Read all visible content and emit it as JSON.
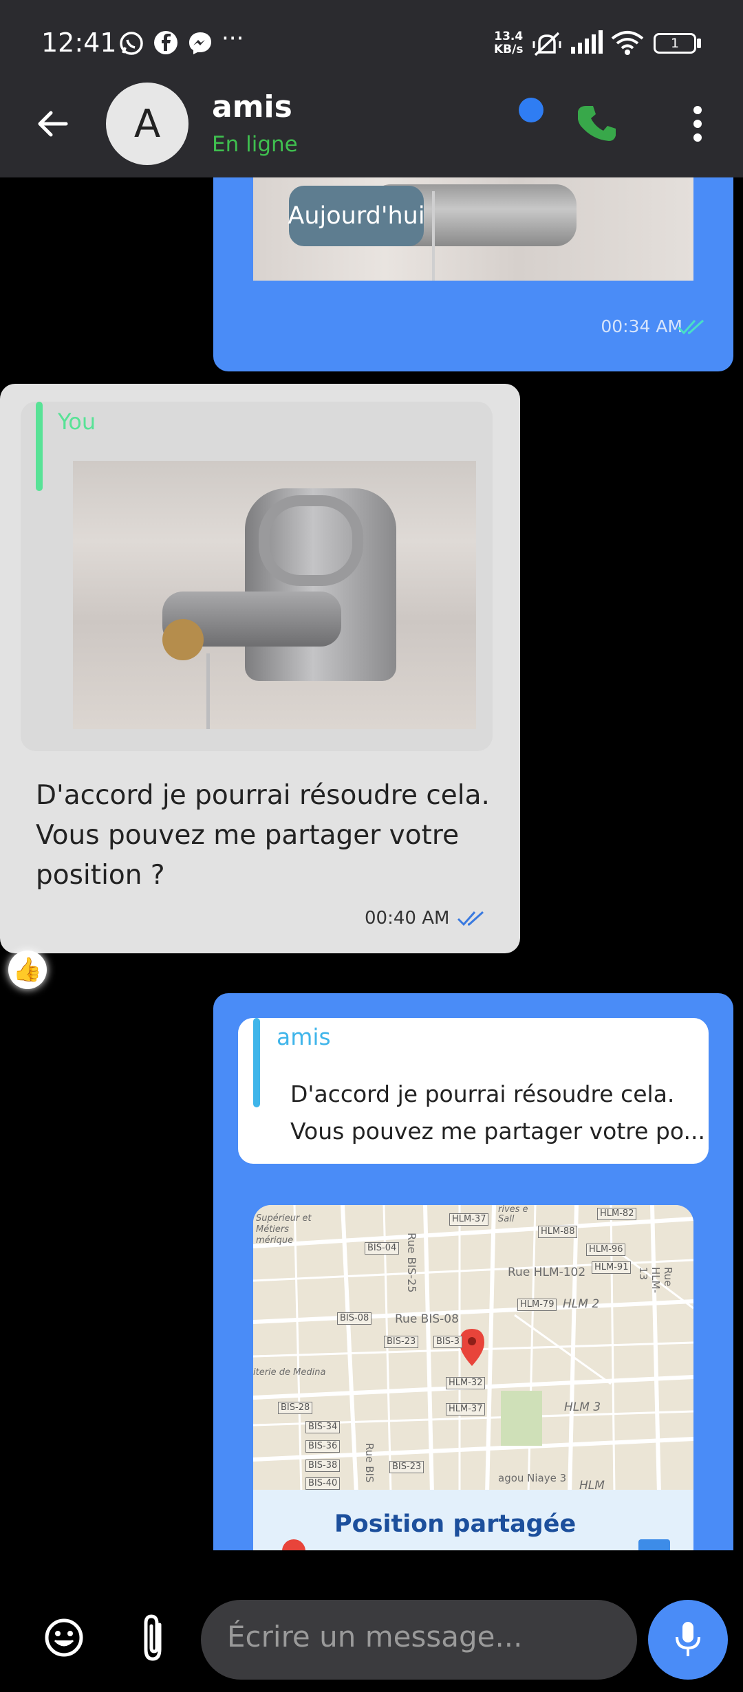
{
  "status_bar": {
    "time": "12:41",
    "net_speed_value": "13.4",
    "net_speed_unit": "KB/s",
    "battery": "1"
  },
  "header": {
    "avatar_initial": "A",
    "contact_name": "amis",
    "contact_status": "En ligne"
  },
  "messages": {
    "first_sent": {
      "date_chip": "Aujourd'hui",
      "time": "00:34 AM"
    },
    "received": {
      "reply_author": "You",
      "text_line1": "D'accord je pourrai résoudre cela.",
      "text_line2": "Vous pouvez me partager votre",
      "text_line3": "position ?",
      "time": "00:40 AM",
      "reaction": "👍"
    },
    "location_sent": {
      "reply_author": "amis",
      "reply_line1": "D'accord je pourrai résoudre cela.",
      "reply_line2": "Vous pouvez me partager votre po...",
      "map_title": "Position partagée",
      "map_labels": [
        "HLM-37",
        "Rue BIS-25",
        "HLM-88",
        "HLM-82",
        "HLM-96",
        "HLM-91",
        "BIS-04",
        "Rue HLM-102",
        "HLM-79",
        "HLM 2",
        "Rue HLM-13",
        "BIS-08",
        "Rue BIS-08",
        "BIS-23",
        "BIS-3",
        "HLM-32",
        "HLM-37",
        "HLM 3",
        "BIS-28",
        "BIS-34",
        "BIS-36",
        "BIS-38",
        "BIS-40",
        "BIS-23",
        "Rue BIS",
        "agou Niaye 3",
        "HLM",
        "Supérieur et Métiers mérique",
        "iterie de Medina",
        "rives e Sall"
      ]
    }
  },
  "composer": {
    "placeholder": "Écrire un message..."
  },
  "colors": {
    "bar_bg": "#2b2b2f",
    "sent_bubble": "#4a8cf7",
    "received_bubble": "#e2e2e2",
    "online_green": "#3fbf4f",
    "call_green": "#38a84a"
  }
}
